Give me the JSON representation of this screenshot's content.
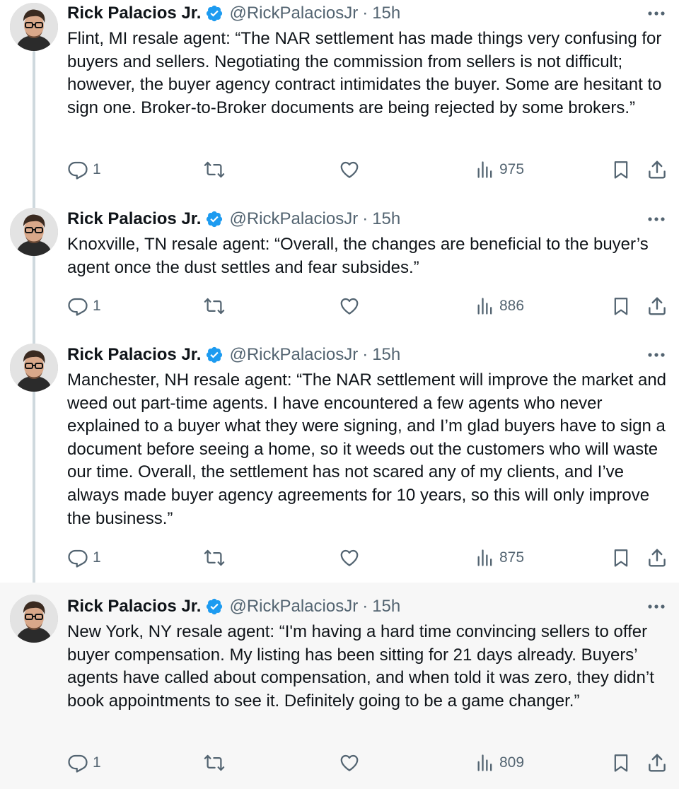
{
  "author": {
    "name": "Rick Palacios Jr.",
    "handle": "@RickPalaciosJr",
    "separator": "·",
    "time": "15h",
    "verified_color": "#1d9bf0"
  },
  "colors": {
    "text": "#0f1419",
    "secondary": "#536471",
    "thread_line": "#cfd9de",
    "highlight_bg": "#f7f7f7"
  },
  "tweets": [
    {
      "text": "Flint, MI resale agent: “The NAR settlement has made things very confusing for buyers and sellers. Negotiating the commission from sellers is not difficult; however, the buyer agency contract intimidates the buyer. Some are hesitant to sign one. Broker-to-Broker documents are being rejected by some brokers.”",
      "replies": "1",
      "views": "975"
    },
    {
      "text": "Knoxville, TN resale agent: “Overall, the changes are beneficial to the buyer’s agent once the dust settles and fear subsides.”",
      "replies": "1",
      "views": "886"
    },
    {
      "text": "Manchester, NH resale agent: “The NAR settlement will improve the market and weed out part-time agents. I have encountered a few agents who never explained to a buyer what they were signing, and I’m glad buyers have to sign a document before seeing a home, so it weeds out the customers who will waste our time. Overall, the settlement has not scared any of my clients, and I’ve always made buyer agency agreements for 10 years, so this will only improve the business.”",
      "replies": "1",
      "views": "875"
    },
    {
      "text": "New York, NY resale agent: “I'm having a hard time convincing sellers to offer buyer compensation. My listing has been sitting for 21 days already. Buyers’ agents have called about compensation, and when told it was zero, they didn’t book appointments to see it. Definitely going to be a game changer.”",
      "replies": "1",
      "views": "809"
    }
  ],
  "icons": [
    "verified-badge-icon",
    "more-icon",
    "reply-icon",
    "repost-icon",
    "like-icon",
    "views-icon",
    "bookmark-icon",
    "share-icon"
  ]
}
